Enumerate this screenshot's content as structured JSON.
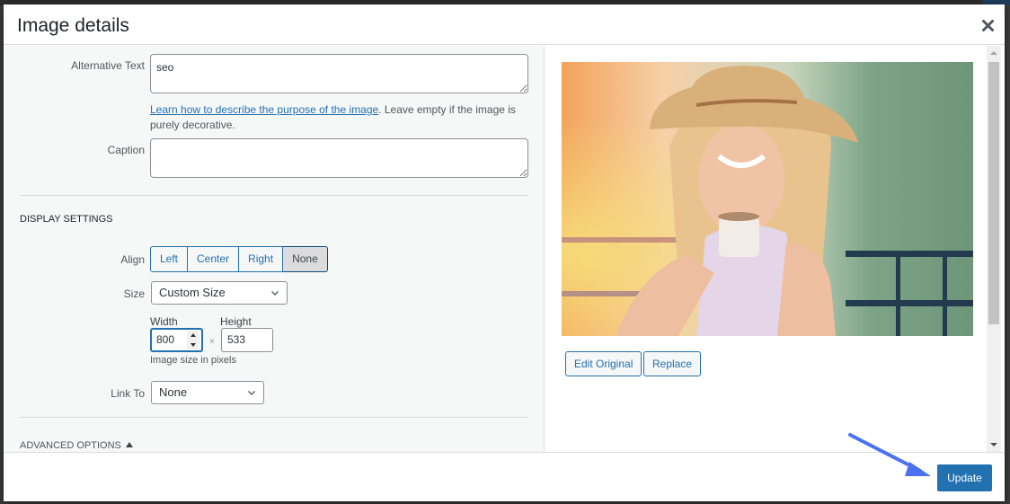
{
  "dialog": {
    "title": "Image details",
    "close_icon": "close-x-icon"
  },
  "form": {
    "alt_text": {
      "label": "Alternative Text",
      "value": "seo"
    },
    "help": {
      "link_text": "Learn how to describe the purpose of the image",
      "rest_text": ". Leave empty if the image is purely decorative."
    },
    "caption": {
      "label": "Caption",
      "value": ""
    }
  },
  "display_settings": {
    "title": "DISPLAY SETTINGS",
    "align": {
      "label": "Align",
      "options": [
        "Left",
        "Center",
        "Right",
        "None"
      ],
      "selected": "None"
    },
    "size": {
      "label": "Size",
      "selected": "Custom Size"
    },
    "custom_size": {
      "width_label": "Width",
      "width_value": "800",
      "times": "×",
      "height_label": "Height",
      "height_value": "533",
      "help": "Image size in pixels"
    },
    "link_to": {
      "label": "Link To",
      "selected": "None"
    }
  },
  "advanced": {
    "title": "ADVANCED OPTIONS"
  },
  "preview": {
    "alt": "seo",
    "description": "Smiling woman in a straw hat holding a coffee cup on a balcony",
    "edit_button": "Edit Original",
    "replace_button": "Replace"
  },
  "footer": {
    "update_button": "Update"
  },
  "colors": {
    "accent": "#2271b1",
    "annotation_arrow": "#4a72f0"
  }
}
